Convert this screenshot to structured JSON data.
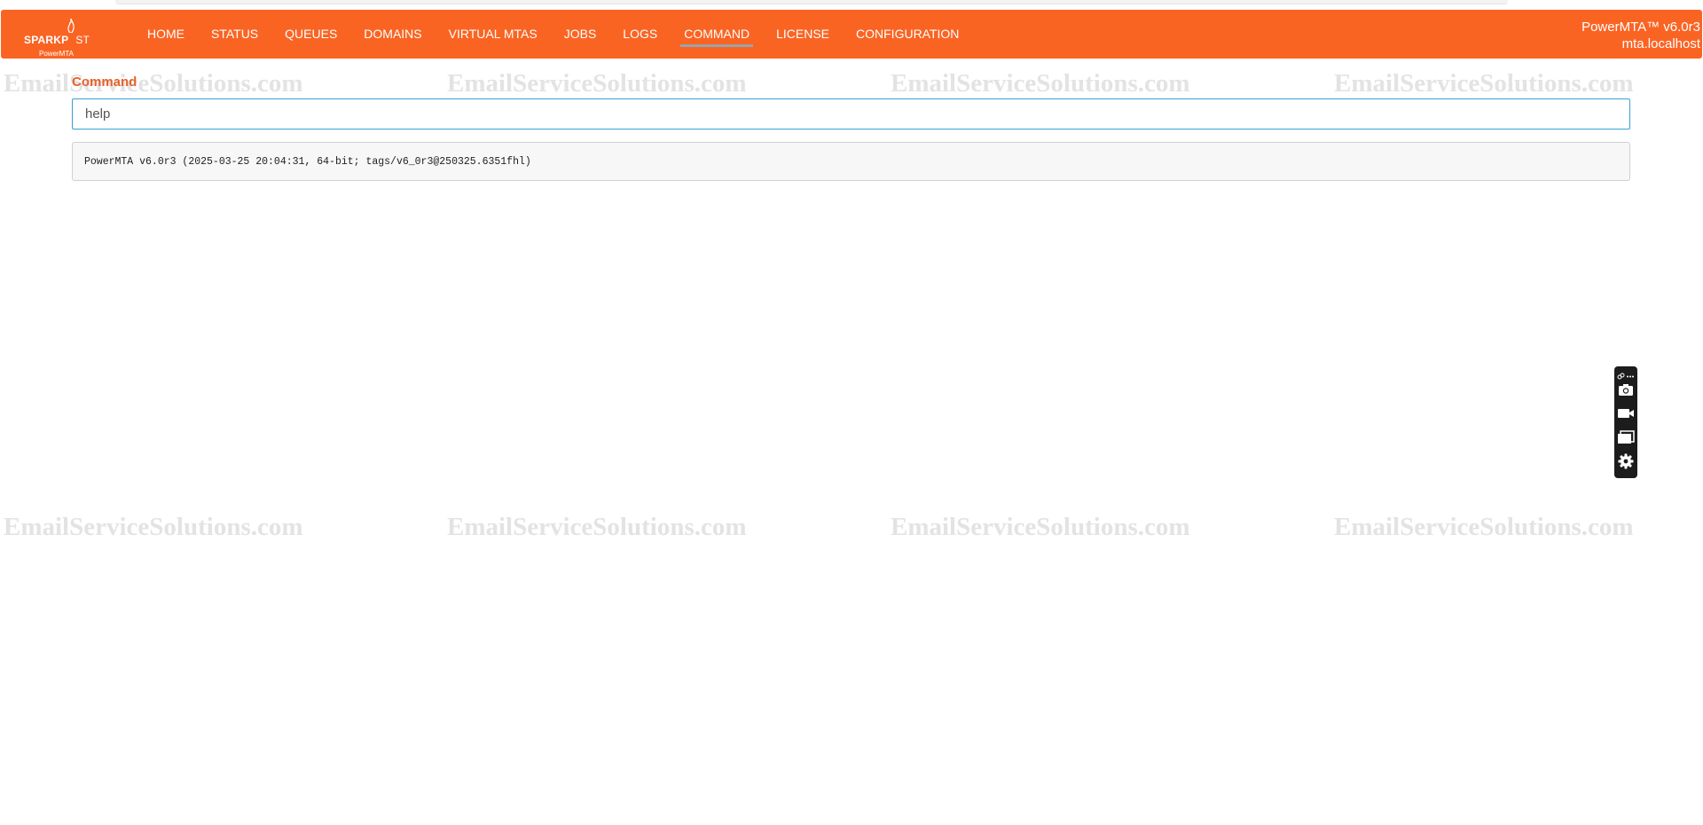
{
  "brand": {
    "logo_bold": "SPARKP",
    "logo_light": "ST",
    "product": "PowerMTA"
  },
  "nav": {
    "items": [
      {
        "label": "HOME"
      },
      {
        "label": "STATUS"
      },
      {
        "label": "QUEUES"
      },
      {
        "label": "DOMAINS"
      },
      {
        "label": "VIRTUAL MTAS"
      },
      {
        "label": "JOBS"
      },
      {
        "label": "LOGS"
      },
      {
        "label": "COMMAND",
        "active": true
      },
      {
        "label": "LICENSE"
      },
      {
        "label": "CONFIGURATION"
      }
    ]
  },
  "host": {
    "version": "PowerMTA™ v6.0r3",
    "hostname": "mta.localhost"
  },
  "watermark": {
    "text": "EmailServiceSolutions.com"
  },
  "command": {
    "title": "Command",
    "input_value": "help",
    "output": "PowerMTA v6.0r3 (2025-03-25 20:04:31, 64-bit; tags/v6_0r3@250325.6351fhl)"
  },
  "toolbar": {
    "icons": [
      "link-icon",
      "more-icon",
      "camera-icon",
      "video-icon",
      "window-icon",
      "gear-icon"
    ]
  },
  "colors": {
    "navbar": "#fa6423",
    "title": "#e8622a",
    "input_border": "#3a9fd6",
    "watermark": "#e3e3e3"
  }
}
